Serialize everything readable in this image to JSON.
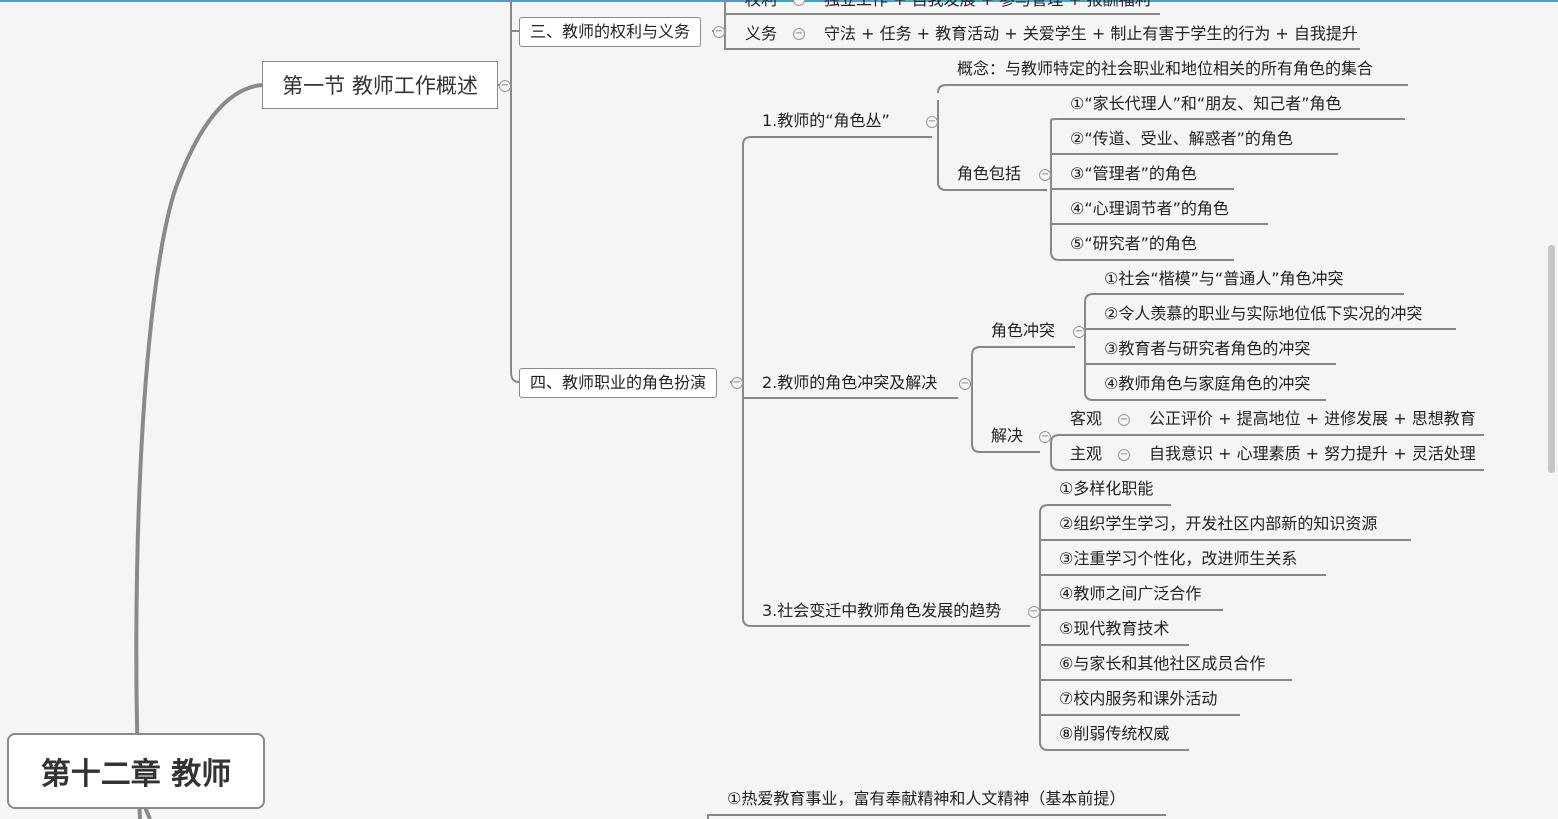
{
  "root": {
    "title": "第十二章 教师"
  },
  "section1": {
    "title": "第一节 教师工作概述"
  },
  "rights_duties": {
    "title": "三、教师的权利与义务",
    "rights_label": "权利",
    "rights_text": "独立工作 + 自我发展 + 参与管理 + 报酬福利",
    "duties_label": "义务",
    "duties_text": "守法 + 任务 + 教育活动 + 关爱学生 + 制止有害于学生的行为 + 自我提升"
  },
  "roles": {
    "title": "四、教师职业的角色扮演",
    "set": {
      "title": "1.教师的“角色丛”",
      "concept": "概念：与教师特定的社会职业和地位相关的所有角色的集合",
      "includes_label": "角色包括",
      "includes": [
        "①“家长代理人”和“朋友、知己者”角色",
        "②“传道、受业、解惑者”的角色",
        "③“管理者”的角色",
        "④“心理调节者”的角色",
        "⑤“研究者”的角色"
      ]
    },
    "conflict": {
      "title": "2.教师的角色冲突及解决",
      "conflict_label": "角色冲突",
      "conflicts": [
        "①社会“楷模”与“普通人”角色冲突",
        "②令人羡慕的职业与实际地位低下实况的冲突",
        "③教育者与研究者角色的冲突",
        "④教师角色与家庭角色的冲突"
      ],
      "solve_label": "解决",
      "objective_label": "客观",
      "objective_text": "公正评价 + 提高地位 + 进修发展 + 思想教育",
      "subjective_label": "主观",
      "subjective_text": "自我意识 + 心理素质 + 努力提升 + 灵活处理"
    },
    "trend": {
      "title": "3.社会变迁中教师角色发展的趋势",
      "items": [
        "①多样化职能",
        "②组织学生学习，开发社区内部新的知识资源",
        "③注重学习个性化，改进师生关系",
        "④教师之间广泛合作",
        "⑤现代教育技术",
        "⑥与家长和其他社区成员合作",
        "⑦校内服务和课外活动",
        "⑧削弱传统权威"
      ]
    }
  },
  "bottom": {
    "text": "①热爱教育事业，富有奉献精神和人文精神（基本前提）"
  }
}
